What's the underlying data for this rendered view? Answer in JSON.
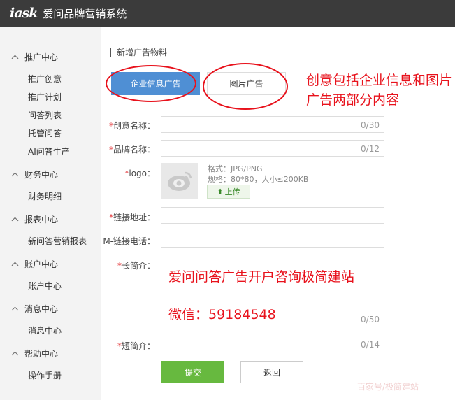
{
  "header": {
    "logo_text": "iask",
    "title": "爱问品牌营销系统"
  },
  "sidebar": {
    "groups": [
      {
        "label": "推广中心",
        "items": [
          "推广创意",
          "推广计划",
          "问答列表",
          "托管问答",
          "AI问答生产"
        ]
      },
      {
        "label": "财务中心",
        "items": [
          "财务明细"
        ]
      },
      {
        "label": "报表中心",
        "items": [
          "新问答营销报表"
        ]
      },
      {
        "label": "账户中心",
        "items": [
          "账户中心"
        ]
      },
      {
        "label": "消息中心",
        "items": [
          "消息中心"
        ]
      },
      {
        "label": "帮助中心",
        "items": [
          "操作手册"
        ]
      }
    ]
  },
  "page": {
    "section_title": "新增广告物料",
    "tabs": [
      {
        "label": "企业信息广告",
        "active": true
      },
      {
        "label": "图片广告",
        "active": false
      }
    ],
    "annotation": "创意包括企业信息和图片广告两部分内容"
  },
  "form": {
    "creative_name": {
      "required": "*",
      "label": "创意名称：",
      "counter": "0/30"
    },
    "brand_name": {
      "required": "*",
      "label": "品牌名称：",
      "counter": "0/12"
    },
    "logo": {
      "required": "*",
      "label": "logo：",
      "format": "格式：JPG/PNG",
      "spec": "规格：80*80，大小≤200KB",
      "upload_label": "上传"
    },
    "link_url": {
      "required": "*",
      "label": "链接地址："
    },
    "m_phone": {
      "label": "M-链接电话："
    },
    "long_intro": {
      "required": "*",
      "label": "长简介：",
      "counter": "0/50"
    },
    "short_intro": {
      "required": "*",
      "label": "短简介：",
      "counter": "0/14"
    },
    "submit_label": "提交",
    "back_label": "返回"
  },
  "overlay": {
    "line1": "爱问问答广告开户咨询极简建站",
    "line2": "微信：59184548"
  },
  "watermark": "百家号/极简建站",
  "colors": {
    "topbar": "#3b3b3b",
    "accent_blue": "#4f8fd4",
    "submit_green": "#67b93f",
    "annotation_red": "#e8121c"
  }
}
